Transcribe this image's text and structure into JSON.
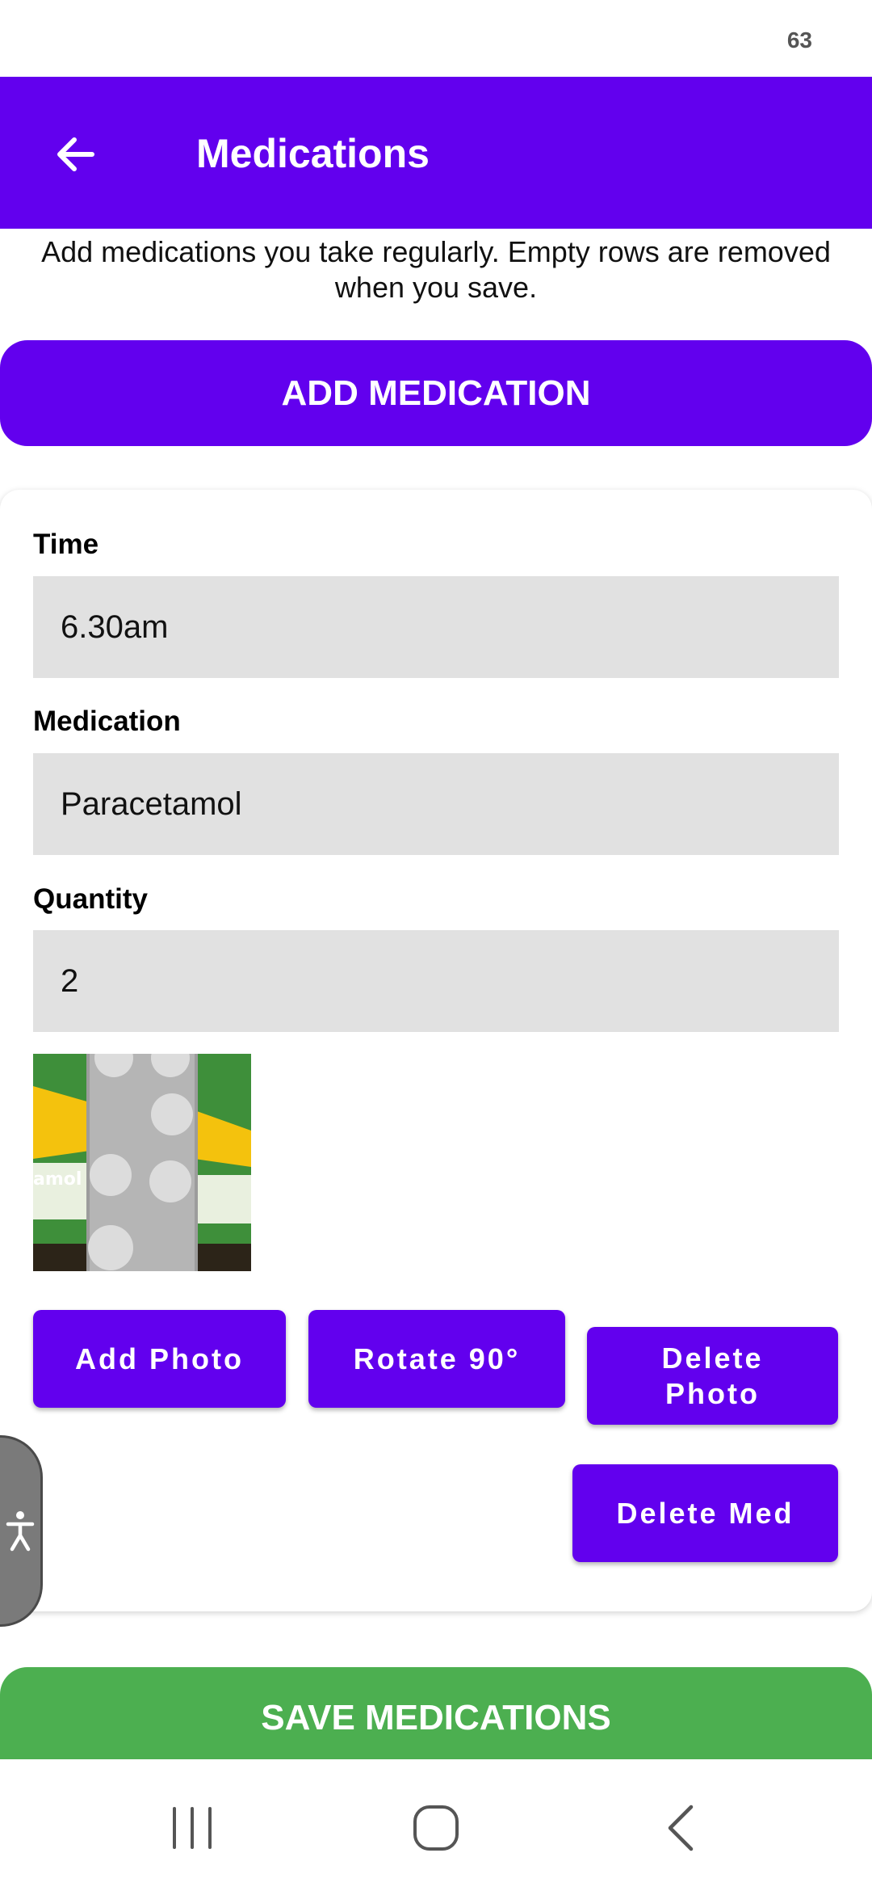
{
  "status_bar": {
    "battery": "63"
  },
  "app_bar": {
    "title": "Medications",
    "back_icon": "arrow-left-icon"
  },
  "intro_text": "Add medications you take regularly. Empty rows are removed when you save.",
  "add_medication_label": "ADD MEDICATION",
  "medication": {
    "time_label": "Time",
    "time_value": "6.30am",
    "name_label": "Medication",
    "name_value": "Paracetamol",
    "quantity_label": "Quantity",
    "quantity_value": "2",
    "photo_text": "amol",
    "add_photo_label": "Add Photo",
    "rotate_label": "Rotate 90°",
    "delete_photo_label": "Delete Photo",
    "delete_med_label": "Delete Med"
  },
  "save_label": "SAVE MEDICATIONS",
  "accessibility_icon": "accessibility-icon",
  "nav_bar": {
    "recents_icon": "recents-icon",
    "home_icon": "home-icon",
    "back_icon": "back-chevron-icon"
  },
  "colors": {
    "primary": "#6200ee",
    "save": "#4caf50",
    "field_bg": "#e1e1e1"
  }
}
